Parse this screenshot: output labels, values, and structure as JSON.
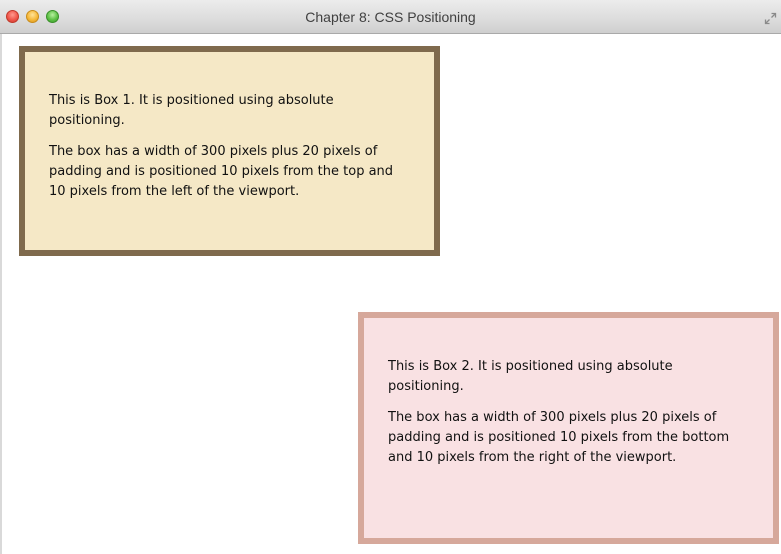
{
  "window": {
    "title": "Chapter 8: CSS Positioning"
  },
  "colors": {
    "box1_background": "#f5e8c6",
    "box1_border": "#7f6a4d",
    "box2_background": "#f9e1e3",
    "box2_border": "#d6a89b"
  },
  "box1": {
    "paragraph1": "This is Box 1. It is positioned using absolute positioning.",
    "paragraph2": "The box has a width of 300 pixels plus 20 pixels of padding and is positioned 10 pixels from the top and 10 pixels from the left of the viewport."
  },
  "box2": {
    "paragraph1": "This is Box 2. It is positioned using absolute positioning.",
    "paragraph2": "The box has a width of 300 pixels plus 20 pixels of padding and is positioned 10 pixels from the bottom and 10 pixels from the right of the viewport."
  }
}
